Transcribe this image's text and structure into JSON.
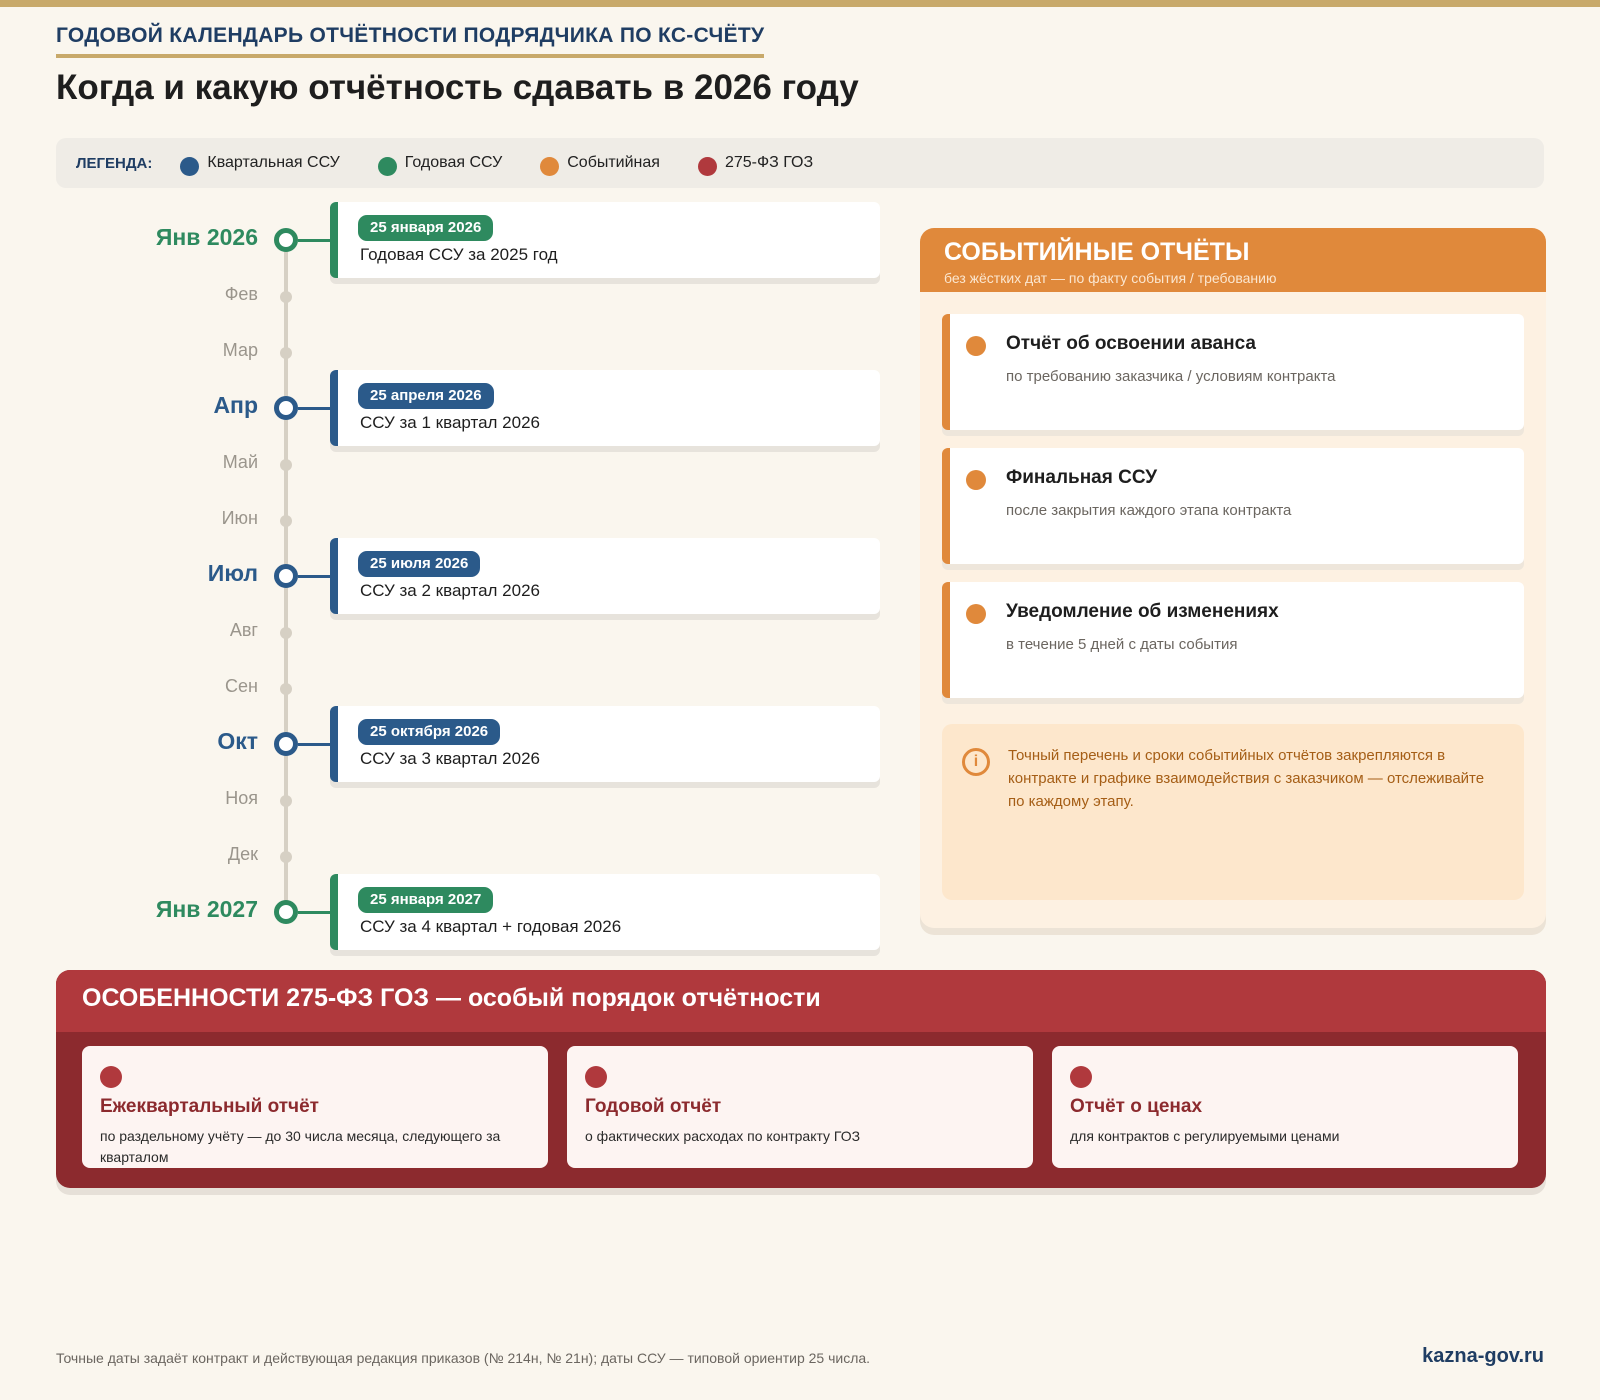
{
  "header": {
    "kicker": "ГОДОВОЙ КАЛЕНДАРЬ ОТЧЁТНОСТИ ПОДРЯДЧИКА ПО КС-СЧЁТУ",
    "title": "Когда и какую отчётность сдавать в 2026 году"
  },
  "legend": {
    "title": "ЛЕГЕНДА:",
    "items": [
      {
        "label": "Квартальная ССУ",
        "color": "#2b5a8a"
      },
      {
        "label": "Годовая ССУ",
        "color": "#2e8a5f"
      },
      {
        "label": "Событийная",
        "color": "#e0893b"
      },
      {
        "label": "275-ФЗ ГОЗ",
        "color": "#b0393d"
      }
    ]
  },
  "timeline": {
    "months": [
      {
        "label": "Янв 2026",
        "major": true,
        "kind": "annual"
      },
      {
        "label": "Фев",
        "major": false
      },
      {
        "label": "Мар",
        "major": false
      },
      {
        "label": "Апр",
        "major": true,
        "kind": "quarterly"
      },
      {
        "label": "Май",
        "major": false
      },
      {
        "label": "Июн",
        "major": false
      },
      {
        "label": "Июл",
        "major": true,
        "kind": "quarterly"
      },
      {
        "label": "Авг",
        "major": false
      },
      {
        "label": "Сен",
        "major": false
      },
      {
        "label": "Окт",
        "major": true,
        "kind": "quarterly"
      },
      {
        "label": "Ноя",
        "major": false
      },
      {
        "label": "Дек",
        "major": false
      },
      {
        "label": "Янв 2027",
        "major": true,
        "kind": "annual"
      }
    ],
    "cards": [
      {
        "date": "25 января 2026",
        "text": "Годовая ССУ за 2025 год",
        "kind": "annual"
      },
      {
        "date": "25 апреля 2026",
        "text": "ССУ за 1 квартал 2026",
        "kind": "quarterly"
      },
      {
        "date": "25 июля 2026",
        "text": "ССУ за 2 квартал 2026",
        "kind": "quarterly"
      },
      {
        "date": "25 октября 2026",
        "text": "ССУ за 3 квартал 2026",
        "kind": "quarterly"
      },
      {
        "date": "25 января 2027",
        "text": "ССУ за 4 квартал + годовая 2026",
        "kind": "annual"
      }
    ]
  },
  "events": {
    "title": "СОБЫТИЙНЫЕ ОТЧЁТЫ",
    "subtitle": "без жёстких дат — по факту события / требованию",
    "items": [
      {
        "title": "Отчёт об освоении аванса",
        "subtitle": "по требованию заказчика / условиям контракта"
      },
      {
        "title": "Финальная ССУ",
        "subtitle": "после закрытия каждого этапа контракта"
      },
      {
        "title": "Уведомление об изменениях",
        "subtitle": "в течение 5 дней с даты события"
      }
    ],
    "note_icon": "info-icon",
    "note": "Точный перечень и сроки событийных отчётов закрепляются в контракте и графике взаимодействия с заказчиком — отслеживайте по каждому этапу."
  },
  "goz": {
    "title": "ОСОБЕННОСТИ 275-ФЗ ГОЗ — особый порядок отчётности",
    "items": [
      {
        "title": "Ежеквартальный отчёт",
        "subtitle": "по раздельному учёту — до 30 числа месяца, следующего за кварталом"
      },
      {
        "title": "Годовой отчёт",
        "subtitle": "о фактических расходах по контракту ГОЗ"
      },
      {
        "title": "Отчёт о ценах",
        "subtitle": "для контрактов с регулируемыми ценами"
      }
    ]
  },
  "footer": {
    "note": "Точные даты задаёт контракт и действующая редакция приказов (№ 214н, № 21н); даты ССУ — типовой ориентир 25 числа.",
    "site": "kazna-gov.ru"
  },
  "colors": {
    "quarterly": "#2b5a8a",
    "annual": "#2e8a5f",
    "event": "#e0893b",
    "goz": "#b0393d"
  }
}
